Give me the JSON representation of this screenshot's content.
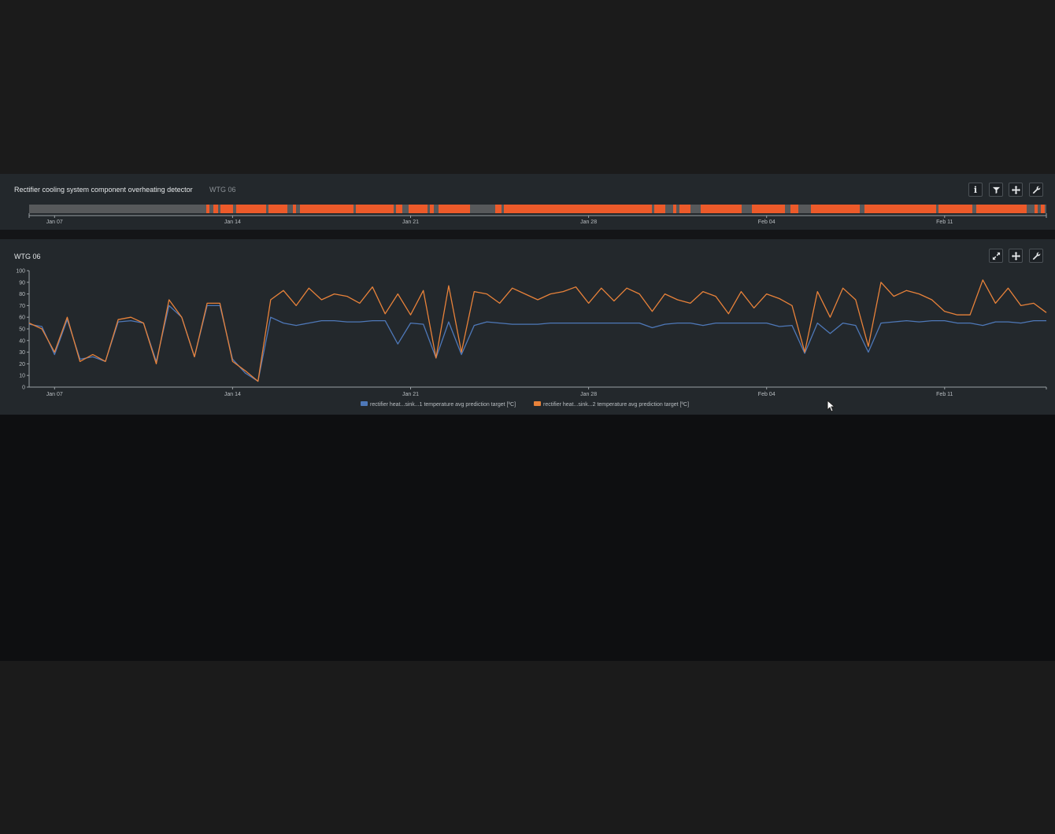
{
  "detector": {
    "title": "Rectifier cooling system component overheating detector",
    "turbine": "WTG 06",
    "timeline_ticks": [
      "Jan 07",
      "Jan 14",
      "Jan 21",
      "Jan 28",
      "Feb 04",
      "Feb 11"
    ],
    "colors": {
      "track": "#57595b",
      "alarm": "#ec5a2a"
    },
    "toolbar_icons": [
      "info-icon",
      "filter-icon",
      "move-icon",
      "wrench-icon"
    ]
  },
  "chart_panel": {
    "title": "WTG 06",
    "toolbar_icons": [
      "expand-icon",
      "move-icon",
      "wrench-icon"
    ]
  },
  "chart_data": {
    "type": "line",
    "x_ticks": [
      "Jan 07",
      "Jan 14",
      "Jan 21",
      "Jan 28",
      "Feb 04",
      "Feb 11"
    ],
    "x_range": [
      "2024-01-06",
      "2024-02-15"
    ],
    "ylim": [
      0,
      100
    ],
    "y_ticks": [
      0,
      10,
      20,
      30,
      40,
      50,
      60,
      70,
      80,
      90,
      100
    ],
    "legend_position": "bottom",
    "series": [
      {
        "name": "rectifier heat...sink...1 temperature avg prediction target [ºC]",
        "color": "#4e78b8",
        "x": [
          "2024-01-06T00:00",
          "2024-01-06T12:00",
          "2024-01-07T00:00",
          "2024-01-07T12:00",
          "2024-01-08T00:00",
          "2024-01-08T12:00",
          "2024-01-09T00:00",
          "2024-01-09T12:00",
          "2024-01-10T00:00",
          "2024-01-10T12:00",
          "2024-01-11T00:00",
          "2024-01-11T12:00",
          "2024-01-12T00:00",
          "2024-01-12T12:00",
          "2024-01-13T00:00",
          "2024-01-13T12:00",
          "2024-01-14T00:00",
          "2024-01-14T12:00",
          "2024-01-15T00:00",
          "2024-01-15T12:00",
          "2024-01-16T00:00",
          "2024-01-16T12:00",
          "2024-01-17T00:00",
          "2024-01-17T12:00",
          "2024-01-18T00:00",
          "2024-01-18T12:00",
          "2024-01-19T00:00",
          "2024-01-19T12:00",
          "2024-01-20T00:00",
          "2024-01-20T12:00",
          "2024-01-21T00:00",
          "2024-01-21T12:00",
          "2024-01-22T00:00",
          "2024-01-22T12:00",
          "2024-01-23T00:00",
          "2024-01-23T12:00",
          "2024-01-24T00:00",
          "2024-01-24T12:00",
          "2024-01-25T00:00",
          "2024-01-25T12:00",
          "2024-01-26T00:00",
          "2024-01-26T12:00",
          "2024-01-27T00:00",
          "2024-01-27T12:00",
          "2024-01-28T00:00",
          "2024-01-28T12:00",
          "2024-01-29T00:00",
          "2024-01-29T12:00",
          "2024-01-30T00:00",
          "2024-01-30T12:00",
          "2024-01-31T00:00",
          "2024-01-31T12:00",
          "2024-02-01T00:00",
          "2024-02-01T12:00",
          "2024-02-02T00:00",
          "2024-02-02T12:00",
          "2024-02-03T00:00",
          "2024-02-03T12:00",
          "2024-02-04T00:00",
          "2024-02-04T12:00",
          "2024-02-05T00:00",
          "2024-02-05T12:00",
          "2024-02-06T00:00",
          "2024-02-06T12:00",
          "2024-02-07T00:00",
          "2024-02-07T12:00",
          "2024-02-08T00:00",
          "2024-02-08T12:00",
          "2024-02-09T00:00",
          "2024-02-09T12:00",
          "2024-02-10T00:00",
          "2024-02-10T12:00",
          "2024-02-11T00:00",
          "2024-02-11T12:00",
          "2024-02-12T00:00",
          "2024-02-12T12:00",
          "2024-02-13T00:00",
          "2024-02-13T12:00",
          "2024-02-14T00:00",
          "2024-02-14T12:00",
          "2024-02-15T00:00"
        ],
        "values": [
          54,
          52,
          28,
          58,
          24,
          26,
          22,
          56,
          57,
          55,
          22,
          70,
          60,
          26,
          70,
          70,
          24,
          12,
          5,
          60,
          55,
          53,
          55,
          57,
          57,
          56,
          56,
          57,
          57,
          37,
          55,
          54,
          25,
          56,
          28,
          53,
          56,
          55,
          54,
          54,
          54,
          55,
          55,
          55,
          55,
          55,
          55,
          55,
          55,
          51,
          54,
          55,
          55,
          53,
          55,
          55,
          55,
          55,
          55,
          52,
          53,
          29,
          55,
          46,
          55,
          53,
          30,
          55,
          56,
          57,
          56,
          57,
          57,
          55,
          55,
          53,
          56,
          56,
          55,
          57,
          57
        ]
      },
      {
        "name": "rectifier heat...sink...2 temperature avg prediction target [ºC]",
        "color": "#e8823a",
        "x": [
          "2024-01-06T00:00",
          "2024-01-06T12:00",
          "2024-01-07T00:00",
          "2024-01-07T12:00",
          "2024-01-08T00:00",
          "2024-01-08T12:00",
          "2024-01-09T00:00",
          "2024-01-09T12:00",
          "2024-01-10T00:00",
          "2024-01-10T12:00",
          "2024-01-11T00:00",
          "2024-01-11T12:00",
          "2024-01-12T00:00",
          "2024-01-12T12:00",
          "2024-01-13T00:00",
          "2024-01-13T12:00",
          "2024-01-14T00:00",
          "2024-01-14T12:00",
          "2024-01-15T00:00",
          "2024-01-15T12:00",
          "2024-01-16T00:00",
          "2024-01-16T12:00",
          "2024-01-17T00:00",
          "2024-01-17T12:00",
          "2024-01-18T00:00",
          "2024-01-18T12:00",
          "2024-01-19T00:00",
          "2024-01-19T12:00",
          "2024-01-20T00:00",
          "2024-01-20T12:00",
          "2024-01-21T00:00",
          "2024-01-21T12:00",
          "2024-01-22T00:00",
          "2024-01-22T12:00",
          "2024-01-23T00:00",
          "2024-01-23T12:00",
          "2024-01-24T00:00",
          "2024-01-24T12:00",
          "2024-01-25T00:00",
          "2024-01-25T12:00",
          "2024-01-26T00:00",
          "2024-01-26T12:00",
          "2024-01-27T00:00",
          "2024-01-27T12:00",
          "2024-01-28T00:00",
          "2024-01-28T12:00",
          "2024-01-29T00:00",
          "2024-01-29T12:00",
          "2024-01-30T00:00",
          "2024-01-30T12:00",
          "2024-01-31T00:00",
          "2024-01-31T12:00",
          "2024-02-01T00:00",
          "2024-02-01T12:00",
          "2024-02-02T00:00",
          "2024-02-02T12:00",
          "2024-02-03T00:00",
          "2024-02-03T12:00",
          "2024-02-04T00:00",
          "2024-02-04T12:00",
          "2024-02-05T00:00",
          "2024-02-05T12:00",
          "2024-02-06T00:00",
          "2024-02-06T12:00",
          "2024-02-07T00:00",
          "2024-02-07T12:00",
          "2024-02-08T00:00",
          "2024-02-08T12:00",
          "2024-02-09T00:00",
          "2024-02-09T12:00",
          "2024-02-10T00:00",
          "2024-02-10T12:00",
          "2024-02-11T00:00",
          "2024-02-11T12:00",
          "2024-02-12T00:00",
          "2024-02-12T12:00",
          "2024-02-13T00:00",
          "2024-02-13T12:00",
          "2024-02-14T00:00",
          "2024-02-14T12:00",
          "2024-02-15T00:00"
        ],
        "values": [
          55,
          50,
          30,
          60,
          22,
          28,
          22,
          58,
          60,
          55,
          20,
          75,
          60,
          26,
          72,
          72,
          22,
          14,
          5,
          75,
          83,
          70,
          85,
          75,
          80,
          78,
          72,
          86,
          63,
          80,
          62,
          83,
          25,
          87,
          30,
          82,
          80,
          72,
          85,
          80,
          75,
          80,
          82,
          86,
          72,
          85,
          74,
          85,
          80,
          65,
          80,
          75,
          72,
          82,
          78,
          63,
          82,
          68,
          80,
          76,
          70,
          30,
          82,
          60,
          85,
          75,
          35,
          90,
          78,
          83,
          80,
          75,
          65,
          62,
          62,
          92,
          72,
          85,
          70,
          72,
          64
        ]
      }
    ]
  }
}
